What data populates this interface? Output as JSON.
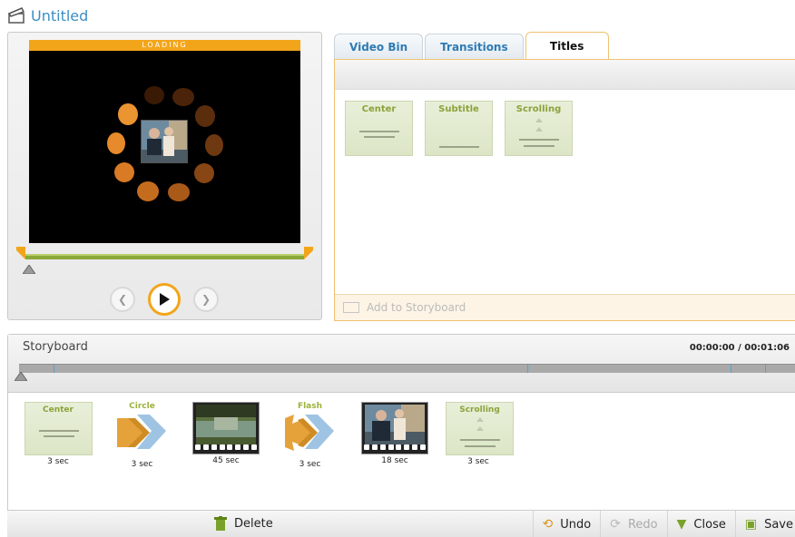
{
  "app": {
    "title": "Untitled"
  },
  "preview": {
    "loading_text": "LOADING"
  },
  "tabs": [
    {
      "label": "Video Bin"
    },
    {
      "label": "Transitions"
    },
    {
      "label": "Titles"
    }
  ],
  "titles_panel": {
    "tiles": [
      {
        "label": "Center"
      },
      {
        "label": "Subtitle"
      },
      {
        "label": "Scrolling"
      }
    ],
    "add_to_storyboard": "Add to Storyboard"
  },
  "storyboard": {
    "title": "Storyboard",
    "time": "00:00:00 / 00:01:06",
    "clips": [
      {
        "kind": "title",
        "label": "Center",
        "duration": "3 sec"
      },
      {
        "kind": "transition",
        "label": "Circle",
        "duration": "3 sec"
      },
      {
        "kind": "video",
        "label": "",
        "duration": "45 sec"
      },
      {
        "kind": "transition",
        "label": "Flash",
        "duration": "3 sec"
      },
      {
        "kind": "video",
        "label": "",
        "duration": "18 sec"
      },
      {
        "kind": "title",
        "label": "Scrolling",
        "duration": "3 sec"
      }
    ]
  },
  "toolbar": {
    "delete": "Delete",
    "undo": "Undo",
    "redo": "Redo",
    "close": "Close",
    "save": "Save"
  },
  "colors": {
    "accent_blue": "#3b8fc4",
    "accent_orange": "#f3a51a",
    "title_green": "#8ca23a"
  }
}
